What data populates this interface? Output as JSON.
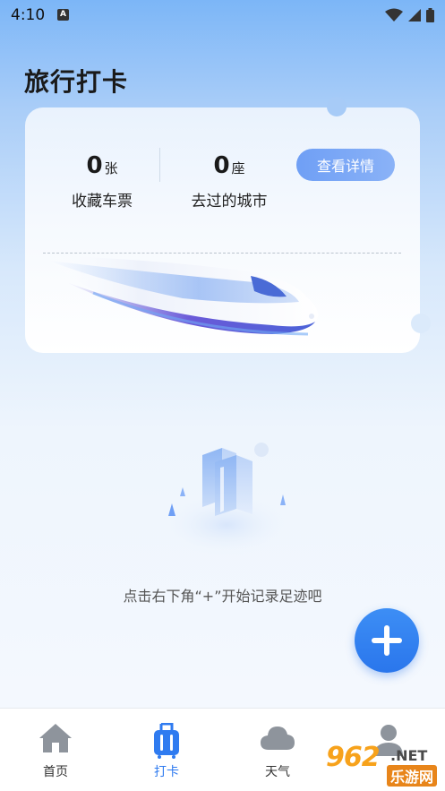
{
  "status_bar": {
    "time": "4:10",
    "icons": [
      "a-notification-icon",
      "wifi-icon",
      "signal-icon",
      "battery-icon"
    ]
  },
  "page": {
    "title": "旅行打卡"
  },
  "card": {
    "tickets_value": "0",
    "tickets_unit": "张",
    "tickets_label": "收藏车票",
    "cities_value": "0",
    "cities_unit": "座",
    "cities_label": "去过的城市",
    "details_button": "查看详情"
  },
  "empty_state": {
    "text": "点击右下角“+”开始记录足迹吧"
  },
  "bottom_nav": {
    "items": [
      {
        "label": "首页",
        "icon": "home-icon",
        "active": false
      },
      {
        "label": "打卡",
        "icon": "luggage-icon",
        "active": true
      },
      {
        "label": "天气",
        "icon": "cloud-icon",
        "active": false
      },
      {
        "label": "",
        "icon": "profile-icon",
        "active": false
      }
    ]
  },
  "watermark": {
    "number": "962",
    "suffix": ".NET",
    "site": "乐游网"
  },
  "colors": {
    "accent": "#2f7bf0",
    "fab": "#3d8ef5",
    "button": "#7aa8f6"
  }
}
